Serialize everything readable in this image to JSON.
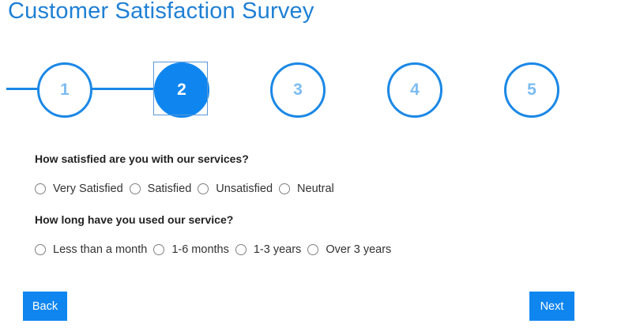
{
  "page": {
    "title": "Customer Satisfaction Survey"
  },
  "stepper": {
    "steps": [
      {
        "label": "1",
        "state": "completed"
      },
      {
        "label": "2",
        "state": "active"
      },
      {
        "label": "3",
        "state": "pending"
      },
      {
        "label": "4",
        "state": "pending"
      },
      {
        "label": "5",
        "state": "pending"
      }
    ],
    "current_step": 2
  },
  "questions": [
    {
      "text": "How satisfied are you with our services?",
      "options": [
        "Very Satisfied",
        "Satisfied",
        "Unsatisfied",
        "Neutral"
      ],
      "selected": null
    },
    {
      "text": "How long have you used our service?",
      "options": [
        "Less than a month",
        "1-6 months",
        "1-3 years",
        "Over 3 years"
      ],
      "selected": null
    }
  ],
  "buttons": {
    "back_label": "Back",
    "next_label": "Next"
  },
  "colors": {
    "accent": "#0f86ef",
    "title": "#1f80d4",
    "pending_step_text": "#7cbcf2"
  }
}
